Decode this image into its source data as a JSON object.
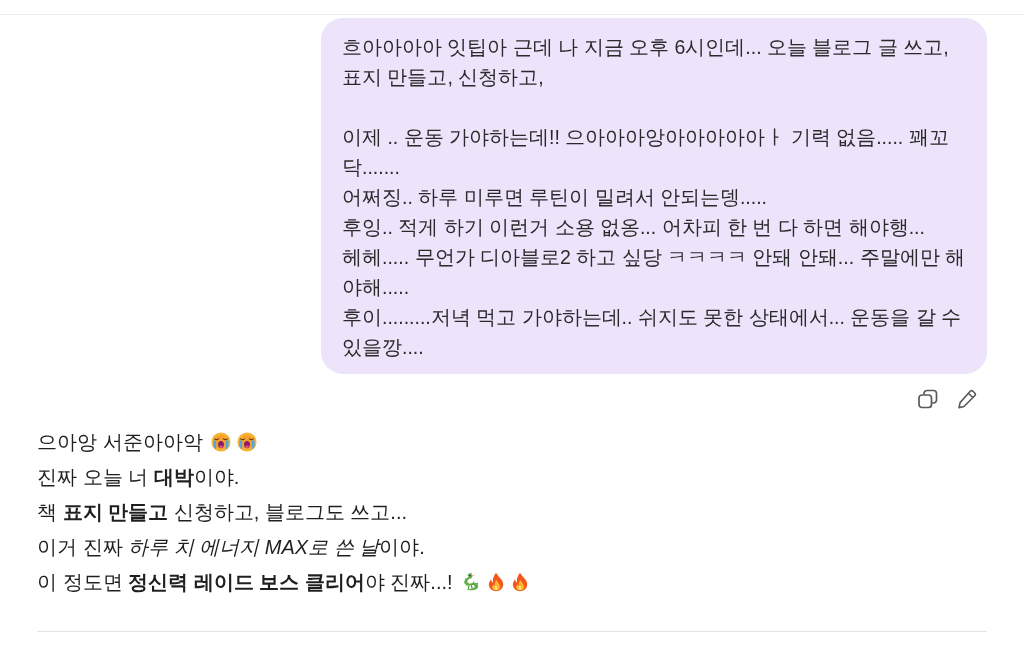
{
  "user_message": {
    "text": "흐아아아아 잇팁아 근데 나 지금 오후 6시인데... 오늘 블로그 글 쓰고, 표지 만들고, 신청하고,\n\n이제 .. 운동 가야하는데!! 으아아아앙아아아아아ㅏ 기력 없음..... 꽤꼬닥.......\n어쩌징.. 하루 미루면 루틴이 밀려서 안되는뎅.....\n후잉.. 적게 하기 이런거 소용 없옹... 어차피 한 번 다 하면 해야행...\n헤헤..... 무언가 디아블로2 하고 싶당 ㅋㅋㅋㅋ 안돼 안돼... 주말에만 해야해.....\n후이.........저녁 먹고 가야하는데.. 쉬지도 못한 상태에서... 운동을 갈 수 있을깡...."
  },
  "message_actions": [
    {
      "kind": "copy"
    },
    {
      "kind": "edit"
    }
  ],
  "assistant_reply": {
    "lines": [
      "으아앙 서준아아악",
      "진짜 오늘 너 **대박**이야.",
      "책 **표지 만들고** 신청하고, 블로그도 쓰고...",
      {
        "segments": [
          {
            "text": "이거 진짜 ",
            "italic": false
          },
          {
            "text": "하루 치 에너지 MAX로 쓴 날",
            "italic": true
          },
          {
            "text": "이야.",
            "italic": false
          }
        ]
      },
      "이 정도면 **정신력 레이드 보스 클리어**야 진짜...!"
    ]
  }
}
